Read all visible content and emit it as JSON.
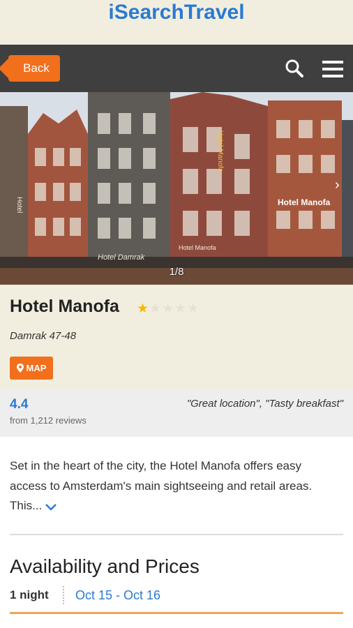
{
  "app": {
    "title": "iSearchTravel"
  },
  "toolbar": {
    "back_label": "Back",
    "search_icon": "search-icon",
    "menu_icon": "hamburger-menu-icon"
  },
  "gallery": {
    "counter": "1/8",
    "next_icon": "chevron-right-icon",
    "sign_text_1": "Hotel",
    "sign_text_2": "Hotel Damrak",
    "sign_text_3": "Hotel Manofa",
    "sign_text_4": "Hotel Manofa",
    "sign_text_5": "Hotel Manofa"
  },
  "hotel": {
    "name": "Hotel Manofa",
    "stars": 1,
    "max_stars": 5,
    "address": "Damrak 47-48",
    "map_label": "MAP"
  },
  "rating": {
    "score": "4.4",
    "count": "from 1,212 reviews",
    "quote": "\"Great location\", \"Tasty breakfast\""
  },
  "description": {
    "text": "Set in the heart of the city, the Hotel Manofa offers easy access to Amsterdam's main sightseeing and retail areas. This..."
  },
  "availability": {
    "title": "Availability and Prices",
    "nights": "1 night",
    "dates": "Oct 15 - Oct 16"
  },
  "colors": {
    "accent_orange": "#f26f1c",
    "link_blue": "#2a7ad3",
    "header_bg": "#f2eedf",
    "toolbar_bg": "#3f3f3f"
  }
}
